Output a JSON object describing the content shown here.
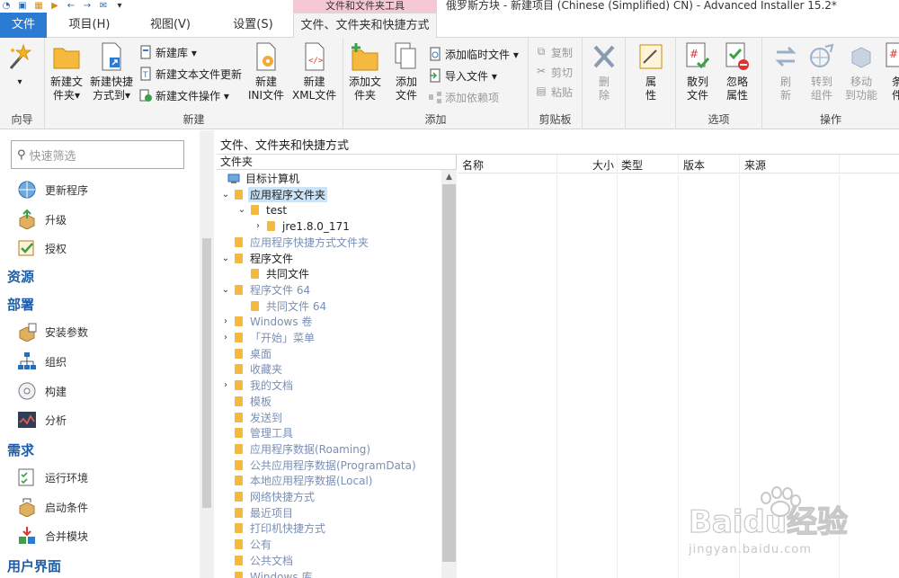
{
  "window": {
    "title": "俄罗斯方块 - 新建项目 (Chinese (Simplified) CN) - Advanced Installer 15.2*",
    "context_tab_header": "文件和文件夹工具"
  },
  "tabs": {
    "file": "文件",
    "project": "项目(H)",
    "view": "视图(V)",
    "settings": "设置(S)",
    "files_folders": "文件、文件夹和快捷方式"
  },
  "ribbon": {
    "wizard": {
      "group": "向导"
    },
    "new": {
      "group": "新建",
      "new_folder": [
        "新建文",
        "件夹▾"
      ],
      "new_shortcut": [
        "新建快捷",
        "方式到▾"
      ],
      "new_library": "新建库 ▾",
      "new_text_update": "新建文本文件更新",
      "new_file_op": "新建文件操作 ▾",
      "new_ini": [
        "新建",
        "INI文件"
      ],
      "new_xml": [
        "新建",
        "XML文件"
      ]
    },
    "add": {
      "group": "添加",
      "add_folder": [
        "添加文",
        "件夹"
      ],
      "add_file": [
        "添加",
        "文件"
      ],
      "add_temp_file": "添加临时文件 ▾",
      "import_file": "导入文件 ▾",
      "add_dependency": "添加依赖项"
    },
    "clipboard": {
      "group": "剪贴板",
      "copy": "复制",
      "cut": "剪切",
      "paste": "粘贴"
    },
    "delete": [
      "删",
      "除"
    ],
    "properties": [
      "属",
      "性"
    ],
    "options": {
      "group": "选项",
      "scatter_file": [
        "散列",
        "文件"
      ],
      "ignore_attr": [
        "忽略",
        "属性"
      ]
    },
    "operations": {
      "group": "操作",
      "refresh": [
        "刷",
        "新"
      ],
      "goto_component": [
        "转到",
        "组件"
      ],
      "move_to_feature": [
        "移动",
        "到功能"
      ],
      "conditions": [
        "条",
        "件"
      ]
    }
  },
  "left_panel": {
    "search_placeholder": "快速筛选",
    "items_top": [
      "更新程序",
      "升级",
      "授权"
    ],
    "section_resources": "资源",
    "section_deploy": "部署",
    "deploy_items": [
      "安装参数",
      "组织",
      "构建",
      "分析"
    ],
    "section_requirements": "需求",
    "requirements_items": [
      "运行环境",
      "启动条件",
      "合并模块"
    ],
    "section_ui": "用户界面"
  },
  "main": {
    "title": "文件、文件夹和快捷方式",
    "tree_header": "文件夹",
    "tree": [
      {
        "label": "目标计算机",
        "indent": 0,
        "exp": "",
        "kind": "computer",
        "dim": false,
        "sel": false
      },
      {
        "label": "应用程序文件夹",
        "indent": 0,
        "exp": "⌄",
        "kind": "folder",
        "dim": false,
        "sel": true
      },
      {
        "label": "test",
        "indent": 1,
        "exp": "⌄",
        "kind": "folder",
        "dim": false,
        "sel": false
      },
      {
        "label": "jre1.8.0_171",
        "indent": 2,
        "exp": "›",
        "kind": "folder",
        "dim": false,
        "sel": false
      },
      {
        "label": "应用程序快捷方式文件夹",
        "indent": 0,
        "exp": "",
        "kind": "folder",
        "dim": true,
        "sel": false
      },
      {
        "label": "程序文件",
        "indent": 0,
        "exp": "⌄",
        "kind": "folder",
        "dim": false,
        "sel": false
      },
      {
        "label": "共同文件",
        "indent": 1,
        "exp": "",
        "kind": "folder",
        "dim": false,
        "sel": false
      },
      {
        "label": "程序文件 64",
        "indent": 0,
        "exp": "⌄",
        "kind": "folder",
        "dim": true,
        "sel": false
      },
      {
        "label": "共同文件 64",
        "indent": 1,
        "exp": "",
        "kind": "folder",
        "dim": true,
        "sel": false
      },
      {
        "label": "Windows 卷",
        "indent": 0,
        "exp": "›",
        "kind": "folder",
        "dim": true,
        "sel": false
      },
      {
        "label": "「开始」菜单",
        "indent": 0,
        "exp": "›",
        "kind": "folder",
        "dim": true,
        "sel": false
      },
      {
        "label": "桌面",
        "indent": 0,
        "exp": "",
        "kind": "folder",
        "dim": true,
        "sel": false
      },
      {
        "label": "收藏夹",
        "indent": 0,
        "exp": "",
        "kind": "folder",
        "dim": true,
        "sel": false
      },
      {
        "label": "我的文档",
        "indent": 0,
        "exp": "›",
        "kind": "folder",
        "dim": true,
        "sel": false
      },
      {
        "label": "模板",
        "indent": 0,
        "exp": "",
        "kind": "folder",
        "dim": true,
        "sel": false
      },
      {
        "label": "发送到",
        "indent": 0,
        "exp": "",
        "kind": "folder",
        "dim": true,
        "sel": false
      },
      {
        "label": "管理工具",
        "indent": 0,
        "exp": "",
        "kind": "folder",
        "dim": true,
        "sel": false
      },
      {
        "label": "应用程序数据(Roaming)",
        "indent": 0,
        "exp": "",
        "kind": "folder",
        "dim": true,
        "sel": false
      },
      {
        "label": "公共应用程序数据(ProgramData)",
        "indent": 0,
        "exp": "",
        "kind": "folder",
        "dim": true,
        "sel": false
      },
      {
        "label": "本地应用程序数据(Local)",
        "indent": 0,
        "exp": "",
        "kind": "folder",
        "dim": true,
        "sel": false
      },
      {
        "label": "网络快捷方式",
        "indent": 0,
        "exp": "",
        "kind": "folder",
        "dim": true,
        "sel": false
      },
      {
        "label": "最近项目",
        "indent": 0,
        "exp": "",
        "kind": "folder",
        "dim": true,
        "sel": false
      },
      {
        "label": "打印机快捷方式",
        "indent": 0,
        "exp": "",
        "kind": "folder",
        "dim": true,
        "sel": false
      },
      {
        "label": "公有",
        "indent": 0,
        "exp": "",
        "kind": "folder",
        "dim": true,
        "sel": false
      },
      {
        "label": "公共文档",
        "indent": 0,
        "exp": "",
        "kind": "folder",
        "dim": true,
        "sel": false
      },
      {
        "label": "Windows 库",
        "indent": 0,
        "exp": "",
        "kind": "folder",
        "dim": true,
        "sel": false
      }
    ],
    "list_columns": [
      "名称",
      "大小",
      "类型",
      "版本",
      "来源"
    ]
  },
  "watermark": {
    "brand": "Baidu经验",
    "url": "jingyan.baidu.com"
  },
  "colors": {
    "accent": "#2b7bd3",
    "context_tab": "#f6c8d3",
    "folder": "#f4b93e",
    "selection": "#cce4f7",
    "section_header": "#1f5da8"
  }
}
